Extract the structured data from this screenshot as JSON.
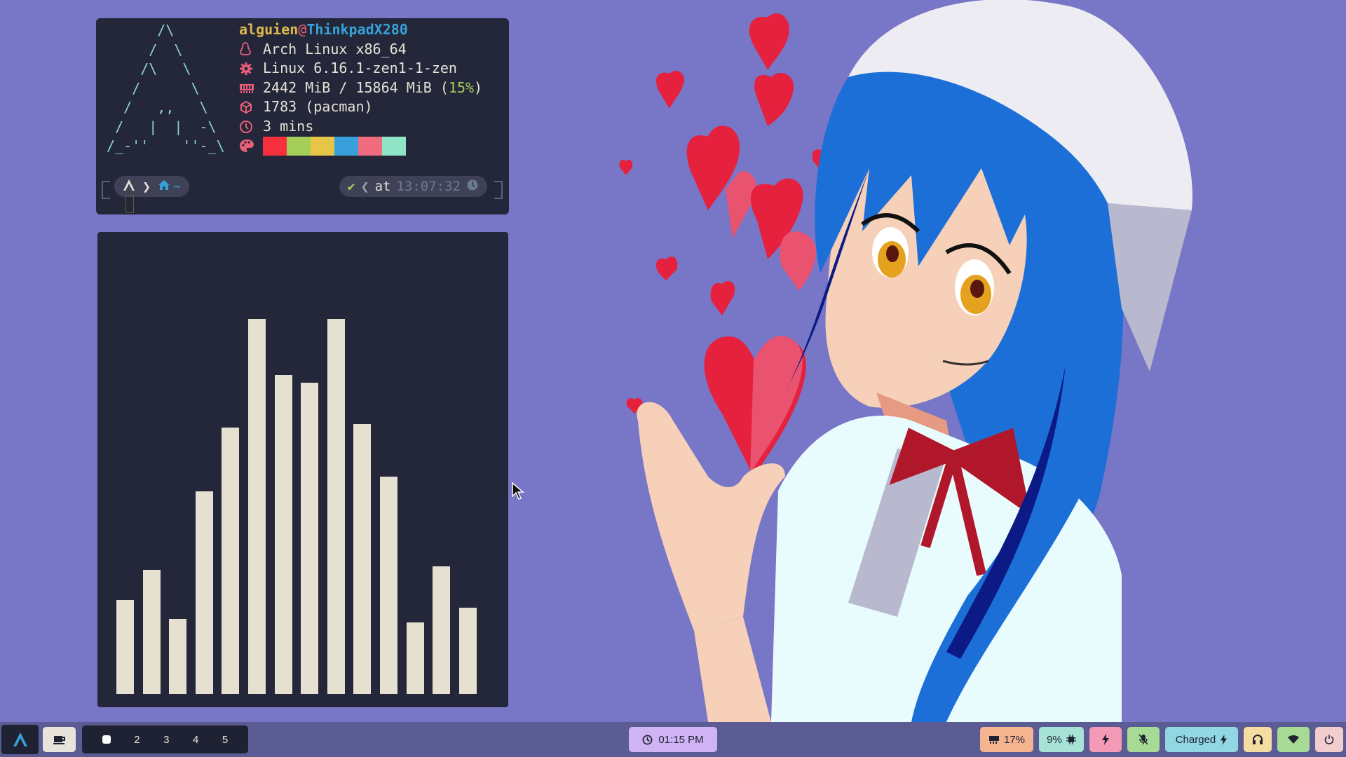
{
  "fetch": {
    "user": "alguien",
    "at": "@",
    "host": "ThinkpadX280",
    "os": "Arch Linux x86_64",
    "kernel": "Linux 6.16.1-zen1-1-zen",
    "memory_used": "2442 MiB / 15864 MiB (",
    "memory_pct": "15%",
    "memory_close": ")",
    "packages": "1783 (pacman)",
    "uptime": "3 mins",
    "palette": [
      "#f8303d",
      "#a6cf5a",
      "#e7c547",
      "#3aa0dc",
      "#f06b7e",
      "#8fe3c7"
    ]
  },
  "prompt": {
    "home": "~",
    "at_label": "at",
    "time": "13:07:32"
  },
  "visualizer": {
    "levels": [
      0.25,
      0.33,
      0.2,
      0.54,
      0.71,
      1.0,
      0.85,
      0.83,
      1.0,
      0.72,
      0.58,
      0.19,
      0.34,
      0.23
    ]
  },
  "taskbar": {
    "workspaces": [
      "2",
      "3",
      "4",
      "5"
    ],
    "clock": "01:15 PM",
    "memory": "17%",
    "cpu": "9%",
    "battery": "Charged"
  },
  "colors": {
    "background": "#7876c6",
    "terminal_bg": "#232739",
    "bar_color": "#e6e0d1",
    "hair": "#1d6fd8",
    "heart": "#e5213e"
  }
}
